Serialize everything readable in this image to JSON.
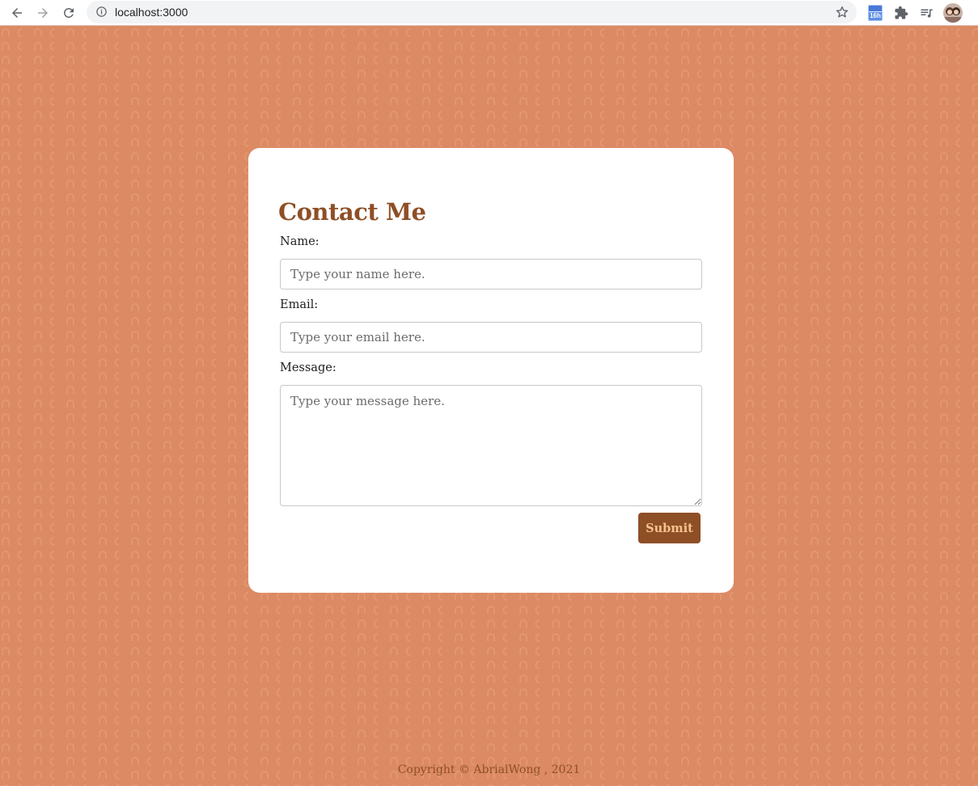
{
  "browser": {
    "url": "localhost:3000",
    "calendar_badge": "16h"
  },
  "form": {
    "title": "Contact Me",
    "name_label": "Name:",
    "name_placeholder": "Type your name here.",
    "email_label": "Email:",
    "email_placeholder": "Type your email here.",
    "message_label": "Message:",
    "message_placeholder": "Type your message here.",
    "submit_label": "Submit"
  },
  "footer": {
    "text": "Copyright © AbrialWong , 2021"
  },
  "colors": {
    "background": "#dc8a63",
    "accent": "#8e4f26",
    "button_text": "#f6c28e",
    "card": "#ffffff"
  },
  "icons": [
    "back-arrow-icon",
    "forward-arrow-icon",
    "reload-icon",
    "info-icon",
    "bookmark-star-icon",
    "calendar-extension-icon",
    "puzzle-extension-icon",
    "reading-list-icon",
    "profile-avatar"
  ]
}
